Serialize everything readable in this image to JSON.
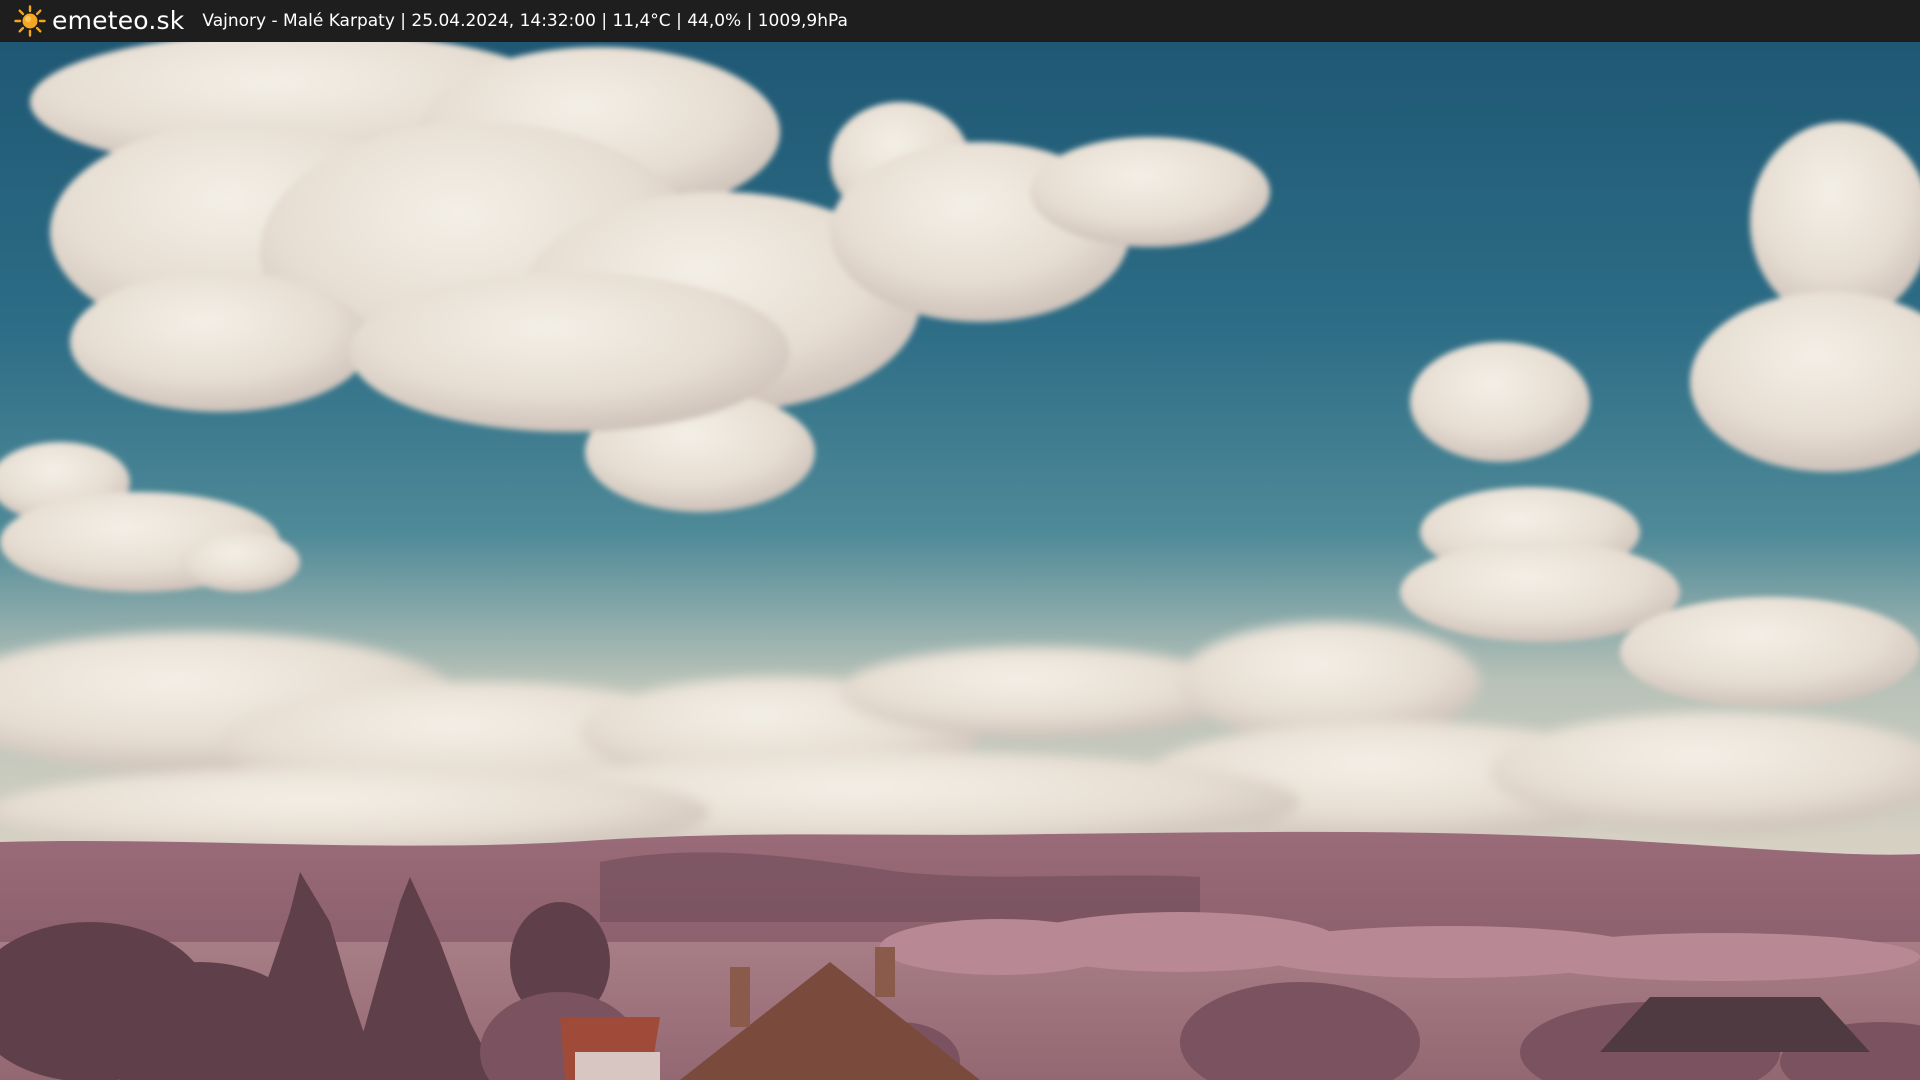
{
  "header": {
    "brand": "emeteo.sk",
    "status": "Vajnory - Malé Karpaty | 25.04.2024, 14:32:00 | 11,4°C | 44,0% | 1009,9hPa",
    "logo_icon": "sun-icon",
    "logo_color": "#f5a623"
  },
  "scene": {
    "description_icon": "webcam-photo",
    "sky_color": "#2f6f8a",
    "land_color": "#9c6a78"
  }
}
